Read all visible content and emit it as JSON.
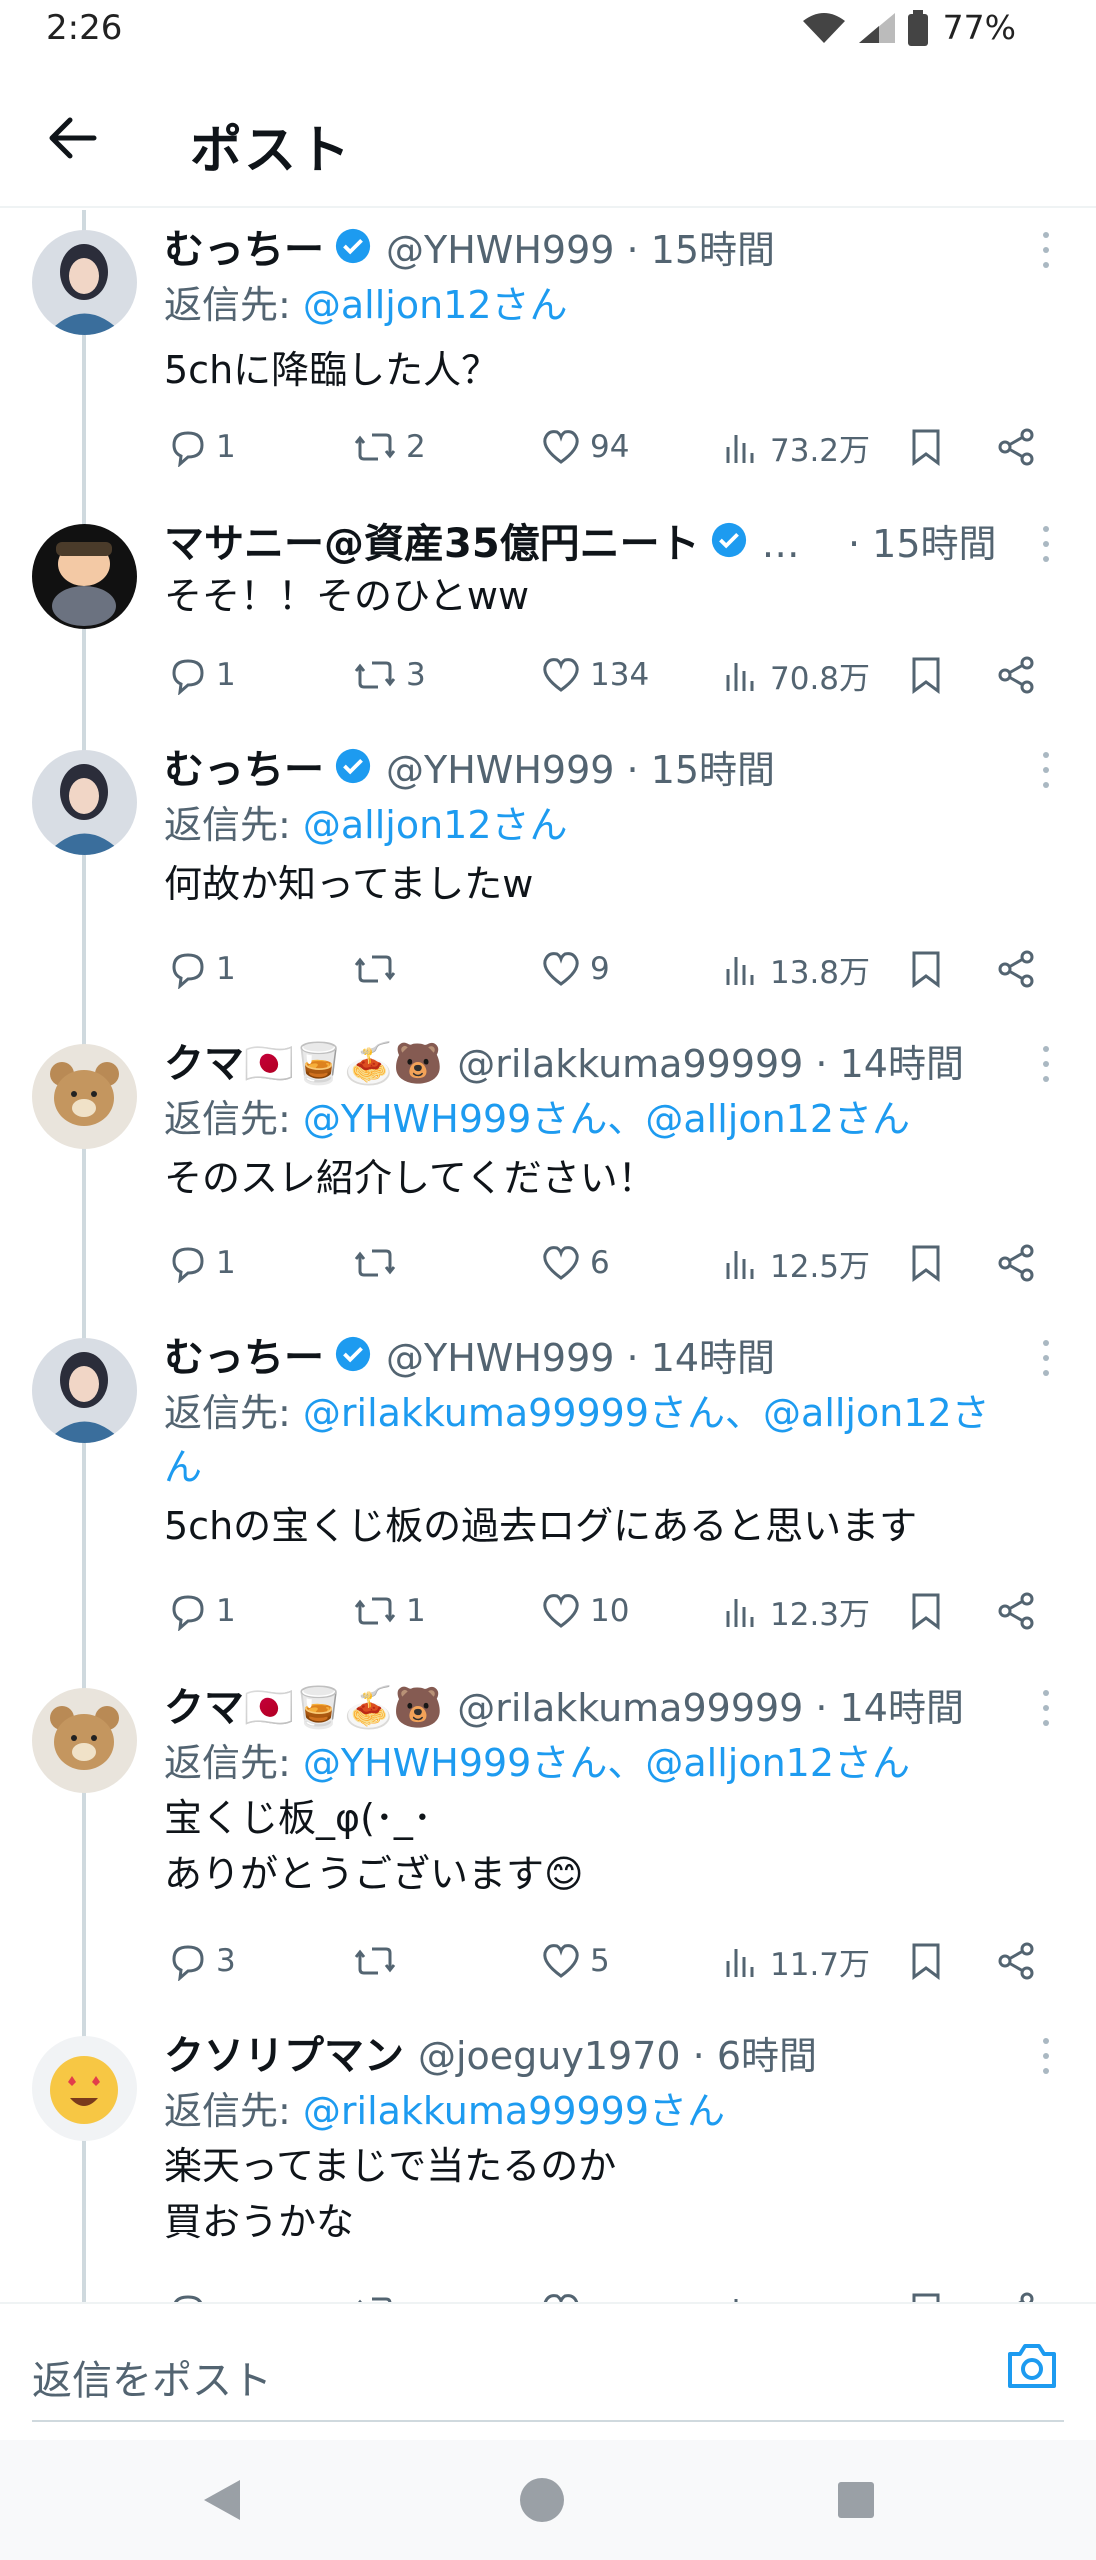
{
  "status": {
    "time": "2:26",
    "battery": "77%"
  },
  "header": {
    "title": "ポスト"
  },
  "tweets": [
    {
      "name": "むっちー",
      "handle_meta": "@YHWH999 · 15時間",
      "verified": true,
      "reply_prefix": "返信先: ",
      "reply_to": "@alljon12さん",
      "reply_to_2": "",
      "text": [
        "5chに降臨した人？"
      ],
      "replies": "1",
      "reposts": "2",
      "likes": "94",
      "views": "73.2万"
    },
    {
      "name": "マサニー@資産35億円ニート",
      "handle_meta": "…    · 15時間",
      "verified": true,
      "reply_prefix": "",
      "reply_to": "",
      "reply_to_2": "",
      "text": [
        "そそ！！そのひとww"
      ],
      "replies": "1",
      "reposts": "3",
      "likes": "134",
      "views": "70.8万"
    },
    {
      "name": "むっちー",
      "handle_meta": "@YHWH999 · 15時間",
      "verified": true,
      "reply_prefix": "返信先: ",
      "reply_to": "@alljon12さん",
      "reply_to_2": "",
      "text": [
        "何故か知ってましたw"
      ],
      "replies": "1",
      "reposts": "",
      "likes": "9",
      "views": "13.8万"
    },
    {
      "name": "クマ🇯🇵🥃🍝🐻",
      "handle_meta": "@rilakkuma99999 · 14時間",
      "verified": false,
      "reply_prefix": "返信先: ",
      "reply_to": "@YHWH999さん、@alljon12さん",
      "reply_to_2": "",
      "text": [
        "そのスレ紹介してください！"
      ],
      "replies": "1",
      "reposts": "",
      "likes": "6",
      "views": "12.5万"
    },
    {
      "name": "むっちー",
      "handle_meta": "@YHWH999 · 14時間",
      "verified": true,
      "reply_prefix": "返信先: ",
      "reply_to": "@rilakkuma99999さん、@alljon12さ",
      "reply_to_2": "ん",
      "text": [
        "5chの宝くじ板の過去ログにあると思います"
      ],
      "replies": "1",
      "reposts": "1",
      "likes": "10",
      "views": "12.3万"
    },
    {
      "name": "クマ🇯🇵🥃🍝🐻",
      "handle_meta": "@rilakkuma99999 · 14時間",
      "verified": false,
      "reply_prefix": "返信先: ",
      "reply_to": "@YHWH999さん、@alljon12さん",
      "reply_to_2": "",
      "text": [
        "宝くじ板_φ(･_･",
        "ありがとうございます😊"
      ],
      "replies": "3",
      "reposts": "",
      "likes": "5",
      "views": "11.7万"
    },
    {
      "name": "クソリプマン",
      "handle_meta": "@joeguy1970 · 6時間",
      "verified": false,
      "reply_prefix": "返信先: ",
      "reply_to": "@rilakkuma99999さん",
      "reply_to_2": "",
      "text": [
        "楽天ってまじで当たるのか",
        "買おうかな"
      ],
      "replies": "",
      "reposts": "",
      "likes": "",
      "views": ""
    }
  ],
  "compose": {
    "placeholder": "返信をポスト"
  },
  "colors": {
    "accent": "#1d9bf0",
    "muted": "#536471",
    "text": "#0f1419"
  }
}
